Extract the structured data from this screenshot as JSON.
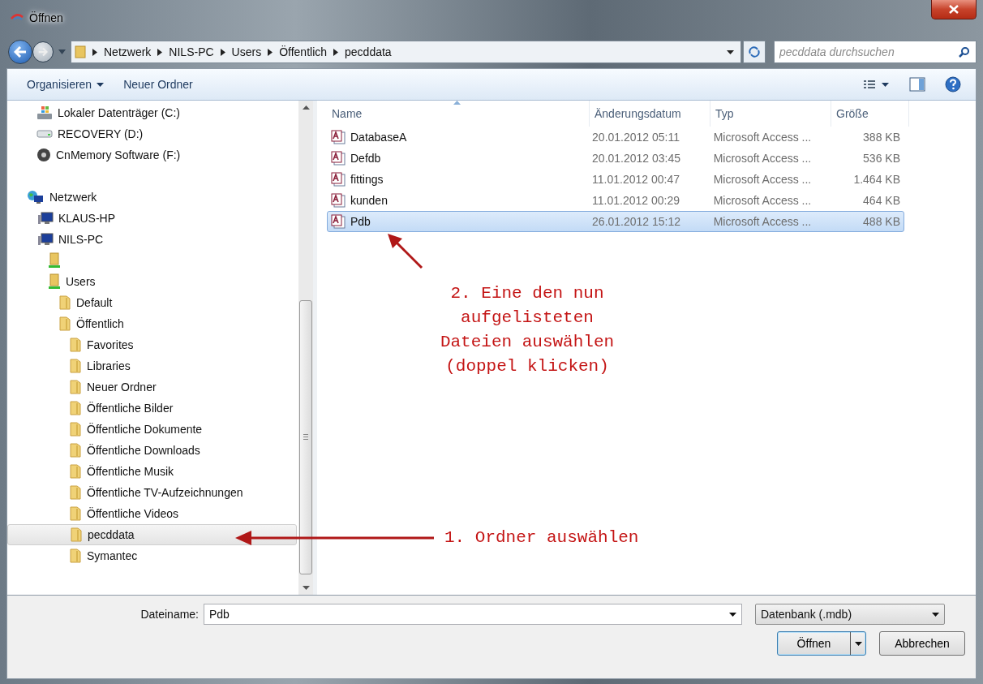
{
  "window": {
    "title": "Öffnen"
  },
  "address_bar": {
    "path": [
      "Netzwerk",
      "NILS-PC",
      "Users",
      "Öffentlich",
      "pecddata"
    ]
  },
  "search": {
    "placeholder": "pecddata durchsuchen"
  },
  "toolbar": {
    "organize": "Organisieren",
    "new_folder": "Neuer Ordner"
  },
  "nav": {
    "scrolled_items": [
      {
        "label": "Lokaler Datenträger (C:)",
        "kind": "system-drive",
        "selected": false
      },
      {
        "label": "RECOVERY (D:)",
        "kind": "drive",
        "selected": false
      },
      {
        "label": "CnMemory Software (F:)",
        "kind": "disc",
        "selected": false
      }
    ],
    "tree": [
      {
        "label": "Netzwerk",
        "kind": "network",
        "selected": false,
        "children": [
          {
            "label": "KLAUS-HP",
            "kind": "computer",
            "selected": false
          },
          {
            "label": "NILS-PC",
            "kind": "computer",
            "selected": false,
            "children": [
              {
                "kind": "share",
                "selected": false
              },
              {
                "label": "Users",
                "kind": "share",
                "selected": false,
                "children": [
                  {
                    "label": "Default",
                    "kind": "folder",
                    "selected": false
                  },
                  {
                    "label": "Öffentlich",
                    "kind": "folder",
                    "selected": false,
                    "children": [
                      {
                        "label": "Favorites",
                        "kind": "folder",
                        "selected": false
                      },
                      {
                        "label": "Libraries",
                        "kind": "folder",
                        "selected": false
                      },
                      {
                        "label": "Neuer Ordner",
                        "kind": "folder",
                        "selected": false
                      },
                      {
                        "label": "Öffentliche Bilder",
                        "kind": "folder",
                        "selected": false
                      },
                      {
                        "label": "Öffentliche Dokumente",
                        "kind": "folder",
                        "selected": false
                      },
                      {
                        "label": "Öffentliche Downloads",
                        "kind": "folder",
                        "selected": false
                      },
                      {
                        "label": "Öffentliche Musik",
                        "kind": "folder",
                        "selected": false
                      },
                      {
                        "label": "Öffentliche TV-Aufzeichnungen",
                        "kind": "folder",
                        "selected": false
                      },
                      {
                        "label": "Öffentliche Videos",
                        "kind": "folder",
                        "selected": false
                      },
                      {
                        "label": "pecddata",
                        "kind": "folder",
                        "selected": true
                      },
                      {
                        "label": "Symantec",
                        "kind": "folder",
                        "selected": false
                      }
                    ]
                  }
                ]
              }
            ]
          }
        ]
      }
    ]
  },
  "files": {
    "columns": [
      "Name",
      "Änderungsdatum",
      "Typ",
      "Größe"
    ],
    "rows": [
      {
        "name": "DatabaseA",
        "date": "20.01.2012 05:11",
        "type": "Microsoft Access ...",
        "size": "388 KB",
        "selected": false
      },
      {
        "name": "Defdb",
        "date": "20.01.2012 03:45",
        "type": "Microsoft Access ...",
        "size": "536 KB",
        "selected": false
      },
      {
        "name": "fittings",
        "date": "11.01.2012 00:47",
        "type": "Microsoft Access ...",
        "size": "1.464 KB",
        "selected": false
      },
      {
        "name": "kunden",
        "date": "11.01.2012 00:29",
        "type": "Microsoft Access ...",
        "size": "464 KB",
        "selected": false
      },
      {
        "name": "Pdb",
        "date": "26.01.2012 15:12",
        "type": "Microsoft Access ...",
        "size": "488 KB",
        "selected": true
      }
    ]
  },
  "footer": {
    "filename_label": "Dateiname:",
    "filename": "Pdb",
    "filter": "Datenbank (.mdb)",
    "open": "Öffnen",
    "cancel": "Abbrechen"
  },
  "annotations": [
    {
      "text": "2. Eine den nun\naufgelisteten\nDateien auswählen\n(doppel klicken)",
      "kind": "file-note"
    },
    {
      "text": "1. Ordner auswählen",
      "kind": "folder-note"
    }
  ]
}
